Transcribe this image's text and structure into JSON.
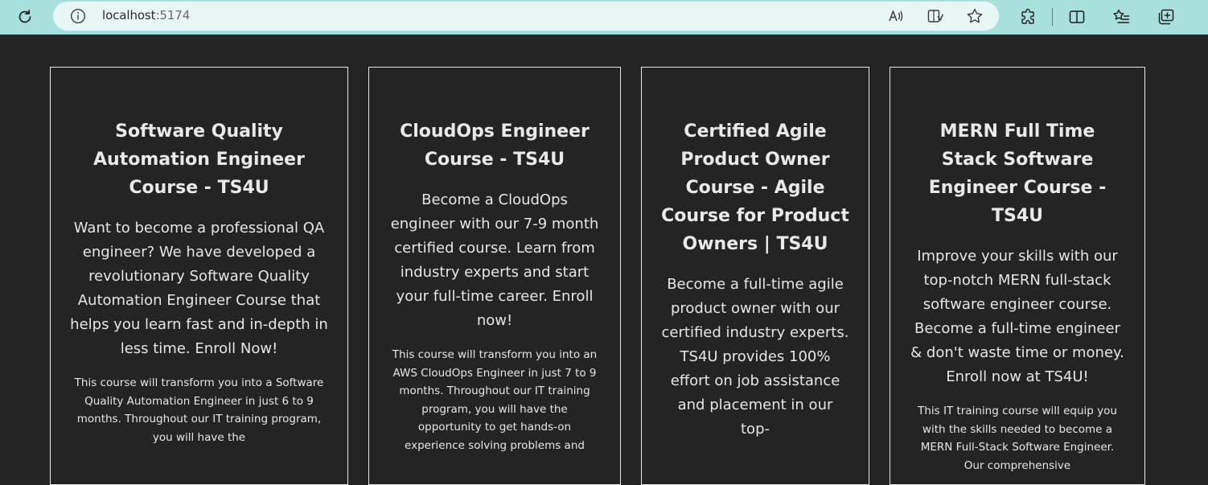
{
  "browser": {
    "url_host": "localhost",
    "url_port": ":5174",
    "icons": {
      "reload": "reload-icon",
      "info": "site-info-icon",
      "read_aloud": "read-aloud-icon",
      "immersive_reader": "immersive-reader-icon",
      "favorite": "favorite-star-icon",
      "extensions": "extensions-icon",
      "split_screen": "split-screen-icon",
      "favorites_list": "favorites-list-icon",
      "collections": "collections-icon"
    },
    "colors": {
      "chrome_bg": "#a8e0dd",
      "address_bg": "#e8f6f5"
    }
  },
  "page": {
    "background": "#242424",
    "cards": [
      {
        "title": "Software Quality Automation Engineer Course - TS4U",
        "lead": "Want to become a professional QA engineer? We have developed a revolutionary Software Quality Automation Engineer Course that helps you learn fast and in-depth in less time. Enroll Now!",
        "body": "This course will transform you into a Software Quality Automation Engineer in just 6 to 9 months. Throughout our IT training program, you will have the"
      },
      {
        "title": "CloudOps Engineer Course - TS4U",
        "lead": "Become a CloudOps engineer with our 7-9 month certified course. Learn from industry experts and start your full-time career. Enroll now!",
        "body": "This course will transform you into an AWS CloudOps Engineer in just 7 to 9 months. Throughout our IT training program, you will have the opportunity to get hands-on experience solving problems and"
      },
      {
        "title": "Certified Agile Product Owner Course - Agile Course for Product Owners | TS4U",
        "lead": "Become a full-time agile product owner with our certified industry experts. TS4U provides 100% effort on job assistance and placement in our top-",
        "body": ""
      },
      {
        "title": "MERN Full Time Stack Software Engineer Course - TS4U",
        "lead": "Improve your skills with our top-notch MERN full-stack software engineer course. Become a full-time engineer & don't waste time or money. Enroll now at TS4U!",
        "body": "This IT training course will equip you with the skills needed to become a MERN Full-Stack Software Engineer. Our comprehensive"
      }
    ]
  }
}
